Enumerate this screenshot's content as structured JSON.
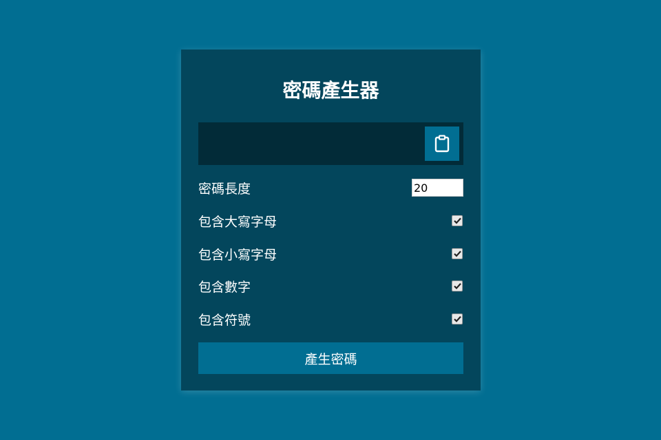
{
  "app": {
    "title": "密碼產生器"
  },
  "result": {
    "password": "",
    "copy_icon": "clipboard-icon"
  },
  "options": {
    "length_label": "密碼長度",
    "length_value": "20",
    "uppercase_label": "包含大寫字母",
    "uppercase_checked": true,
    "lowercase_label": "包含小寫字母",
    "lowercase_checked": true,
    "numbers_label": "包含數字",
    "numbers_checked": true,
    "symbols_label": "包含符號",
    "symbols_checked": true
  },
  "actions": {
    "generate_label": "產生密碼"
  },
  "colors": {
    "page_bg": "#016e92",
    "card_bg": "#03465c",
    "result_bg": "#022b38",
    "accent": "#016e92"
  }
}
